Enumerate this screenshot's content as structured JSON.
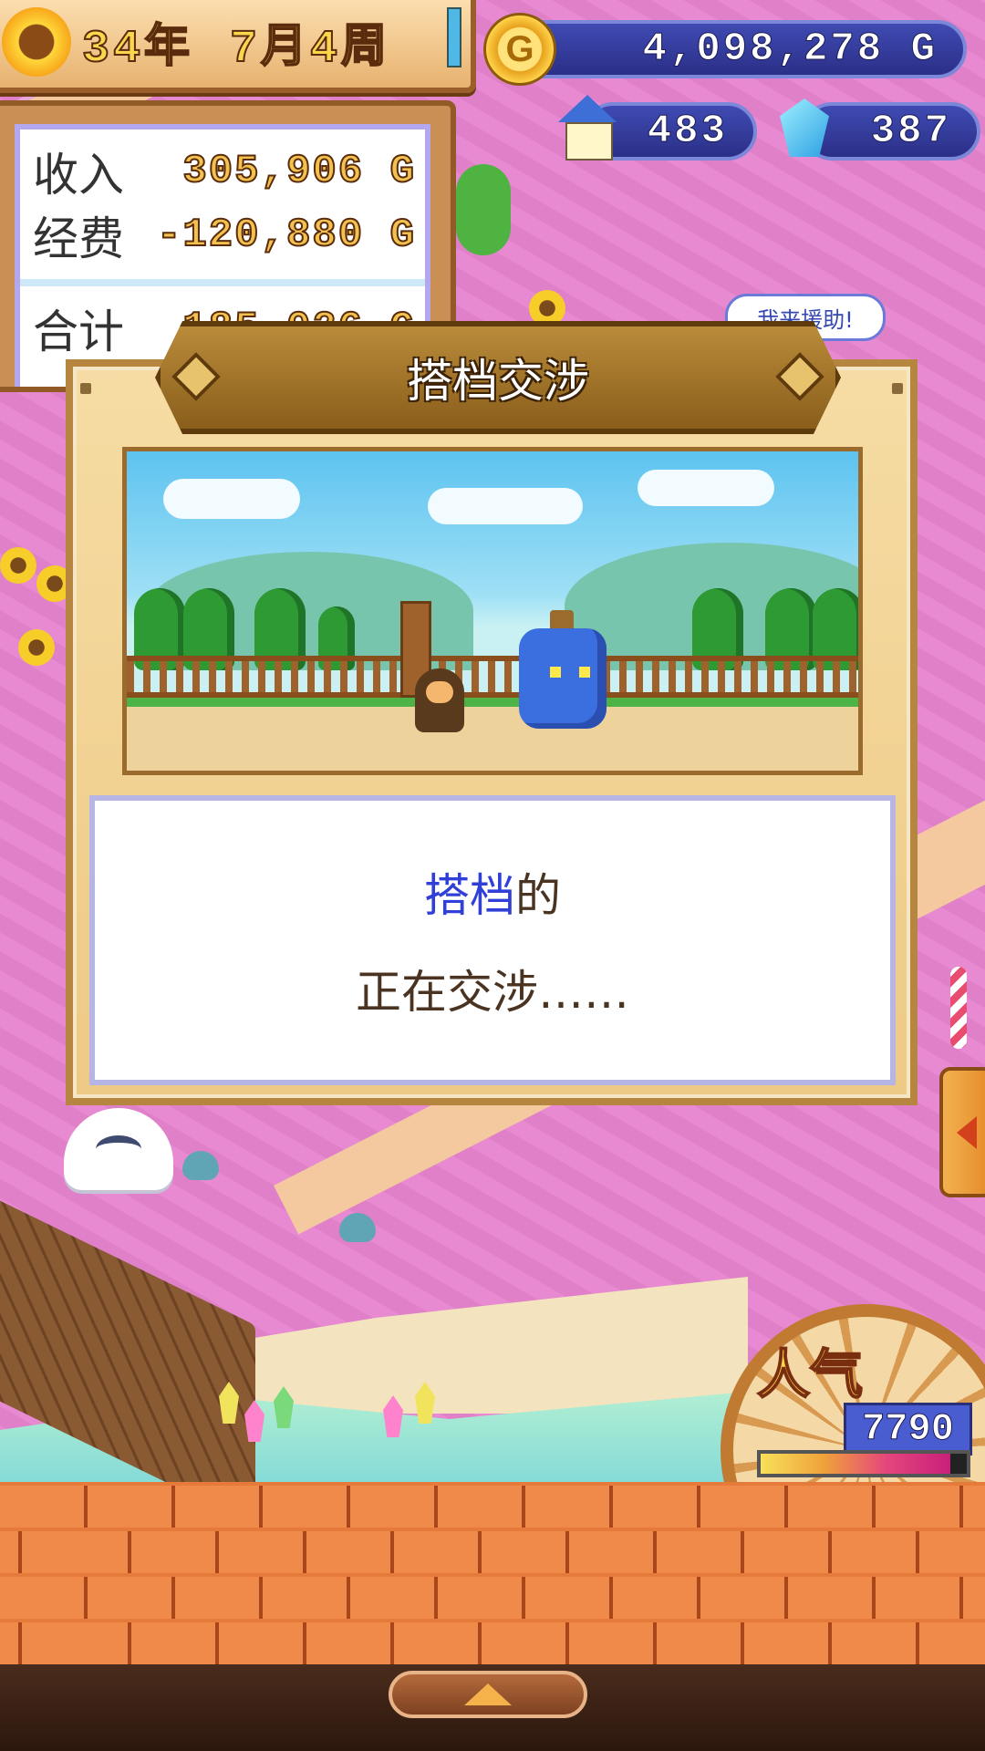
{
  "hud": {
    "year": "34年",
    "month_week": "7月4周",
    "gold": "4,098,278 G",
    "houses": "483",
    "gems": "387",
    "coin_symbol": "G"
  },
  "finance": {
    "income_label": "收入",
    "income_value": "305,906 G",
    "expense_label": "经费",
    "expense_value": "-120,880 G",
    "total_label": "合计",
    "total_value": "185,026 G"
  },
  "world": {
    "help_bubble": "我来援助!"
  },
  "popularity": {
    "label": "人气",
    "value": "7790",
    "fill_fraction": 0.92
  },
  "dialog": {
    "title": "搭档交涉",
    "message_highlight": "搭档",
    "message_suffix": "的",
    "message_line2": "正在交涉……"
  },
  "colors": {
    "highlight": "#2f3fd8",
    "hud_pill": "#2b2f87",
    "brick": "#e57a3a"
  },
  "icons": {
    "coin": "gold-coin-icon",
    "house": "house-icon",
    "gem": "crystal-gem-icon",
    "sun": "sunflower-icon",
    "up": "up-arrow-icon",
    "side": "left-arrow-icon"
  }
}
